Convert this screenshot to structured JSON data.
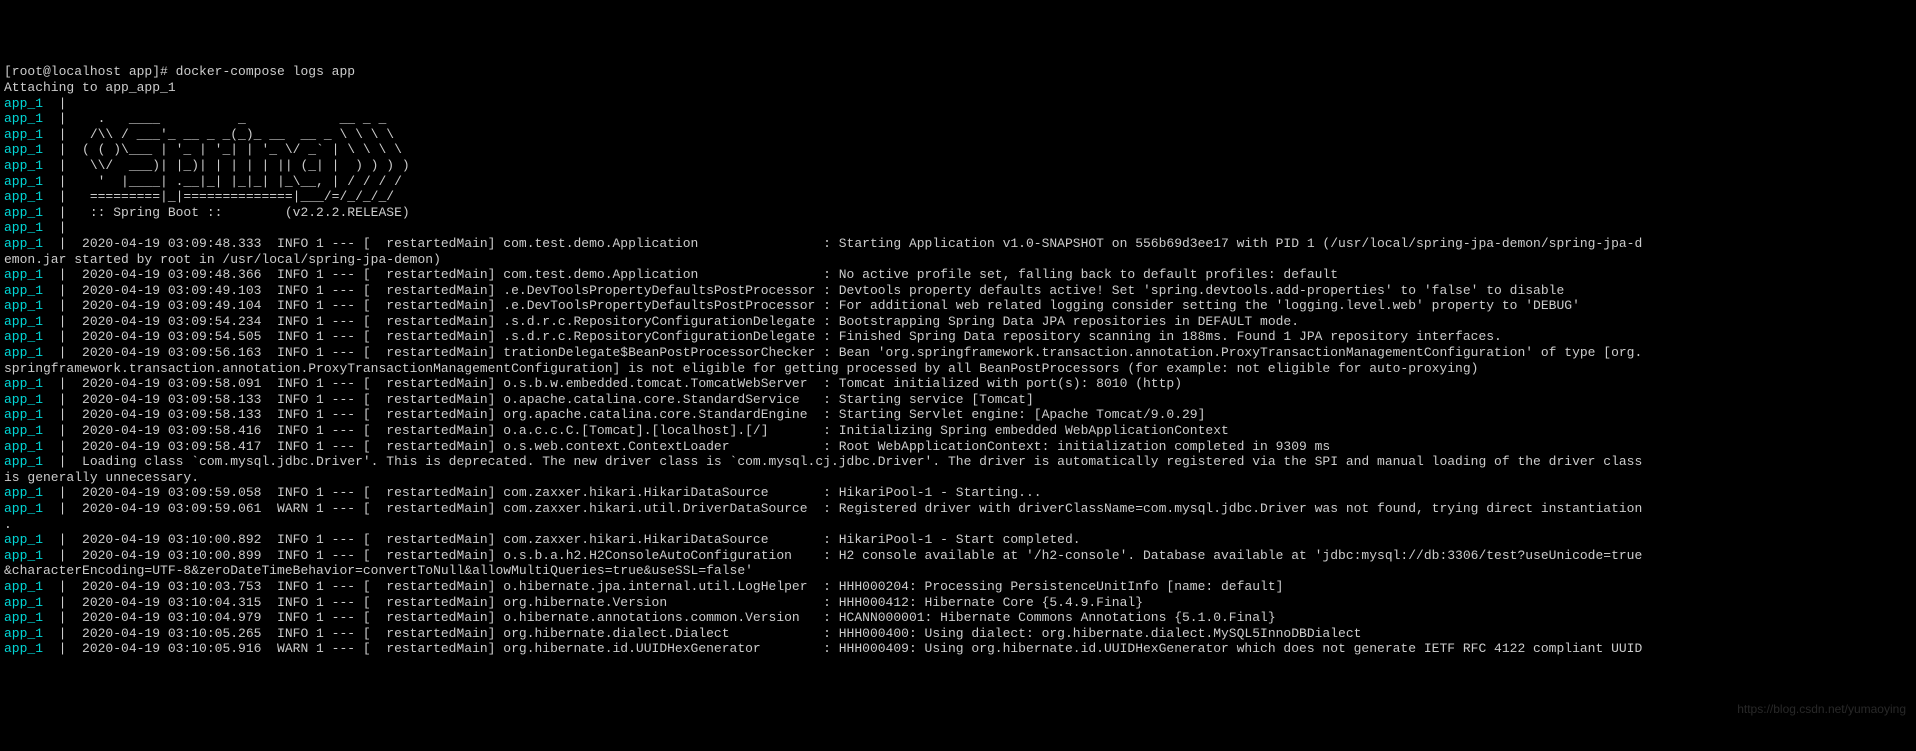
{
  "header": {
    "prompt": "[root@localhost app]# ",
    "command": "docker-compose logs app",
    "attach": "Attaching to app_app_1"
  },
  "prefix": "app_1  ",
  "sep": "| ",
  "lines": [
    " ",
    "   .   ____          _            __ _ _",
    "  /\\\\ / ___'_ __ _ _(_)_ __  __ _ \\ \\ \\ \\",
    " ( ( )\\___ | '_ | '_| | '_ \\/ _` | \\ \\ \\ \\",
    "  \\\\/  ___)| |_)| | | | | || (_| |  ) ) ) )",
    "   '  |____| .__|_| |_|_| |_\\__, | / / / /",
    "  =========|_|==============|___/=/_/_/_/",
    "  :: Spring Boot ::        (v2.2.2.RELEASE)",
    " ",
    " 2020-04-19 03:09:48.333  INFO 1 --- [  restartedMain] com.test.demo.Application                : Starting Application v1.0-SNAPSHOT on 556b69d3ee17 with PID 1 (/usr/local/spring-jpa-demon/spring-jpa-d",
    " 2020-04-19 03:09:48.366  INFO 1 --- [  restartedMain] com.test.demo.Application                : No active profile set, falling back to default profiles: default",
    " 2020-04-19 03:09:49.103  INFO 1 --- [  restartedMain] .e.DevToolsPropertyDefaultsPostProcessor : Devtools property defaults active! Set 'spring.devtools.add-properties' to 'false' to disable",
    " 2020-04-19 03:09:49.104  INFO 1 --- [  restartedMain] .e.DevToolsPropertyDefaultsPostProcessor : For additional web related logging consider setting the 'logging.level.web' property to 'DEBUG'",
    " 2020-04-19 03:09:54.234  INFO 1 --- [  restartedMain] .s.d.r.c.RepositoryConfigurationDelegate : Bootstrapping Spring Data JPA repositories in DEFAULT mode.",
    " 2020-04-19 03:09:54.505  INFO 1 --- [  restartedMain] .s.d.r.c.RepositoryConfigurationDelegate : Finished Spring Data repository scanning in 188ms. Found 1 JPA repository interfaces.",
    " 2020-04-19 03:09:56.163  INFO 1 --- [  restartedMain] trationDelegate$BeanPostProcessorChecker : Bean 'org.springframework.transaction.annotation.ProxyTransactionManagementConfiguration' of type [org.",
    " 2020-04-19 03:09:58.091  INFO 1 --- [  restartedMain] o.s.b.w.embedded.tomcat.TomcatWebServer  : Tomcat initialized with port(s): 8010 (http)",
    " 2020-04-19 03:09:58.133  INFO 1 --- [  restartedMain] o.apache.catalina.core.StandardService   : Starting service [Tomcat]",
    " 2020-04-19 03:09:58.133  INFO 1 --- [  restartedMain] org.apache.catalina.core.StandardEngine  : Starting Servlet engine: [Apache Tomcat/9.0.29]",
    " 2020-04-19 03:09:58.416  INFO 1 --- [  restartedMain] o.a.c.c.C.[Tomcat].[localhost].[/]       : Initializing Spring embedded WebApplicationContext",
    " 2020-04-19 03:09:58.417  INFO 1 --- [  restartedMain] o.s.web.context.ContextLoader            : Root WebApplicationContext: initialization completed in 9309 ms",
    " Loading class `com.mysql.jdbc.Driver'. This is deprecated. The new driver class is `com.mysql.cj.jdbc.Driver'. The driver is automatically registered via the SPI and manual loading of the driver class ",
    " 2020-04-19 03:09:59.058  INFO 1 --- [  restartedMain] com.zaxxer.hikari.HikariDataSource       : HikariPool-1 - Starting...",
    " 2020-04-19 03:09:59.061  WARN 1 --- [  restartedMain] com.zaxxer.hikari.util.DriverDataSource  : Registered driver with driverClassName=com.mysql.jdbc.Driver was not found, trying direct instantiation",
    " 2020-04-19 03:10:00.892  INFO 1 --- [  restartedMain] com.zaxxer.hikari.HikariDataSource       : HikariPool-1 - Start completed.",
    " 2020-04-19 03:10:00.899  INFO 1 --- [  restartedMain] o.s.b.a.h2.H2ConsoleAutoConfiguration    : H2 console available at '/h2-console'. Database available at 'jdbc:mysql://db:3306/test?useUnicode=true",
    " 2020-04-19 03:10:03.753  INFO 1 --- [  restartedMain] o.hibernate.jpa.internal.util.LogHelper  : HHH000204: Processing PersistenceUnitInfo [name: default]",
    " 2020-04-19 03:10:04.315  INFO 1 --- [  restartedMain] org.hibernate.Version                    : HHH000412: Hibernate Core {5.4.9.Final}",
    " 2020-04-19 03:10:04.979  INFO 1 --- [  restartedMain] o.hibernate.annotations.common.Version   : HCANN000001: Hibernate Commons Annotations {5.1.0.Final}",
    " 2020-04-19 03:10:05.265  INFO 1 --- [  restartedMain] org.hibernate.dialect.Dialect            : HHH000400: Using dialect: org.hibernate.dialect.MySQL5InnoDBDialect",
    " 2020-04-19 03:10:05.916  WARN 1 --- [  restartedMain] org.hibernate.id.UUIDHexGenerator        : HHH000409: Using org.hibernate.id.UUIDHexGenerator which does not generate IETF RFC 4122 compliant UUID "
  ],
  "wrapped": {
    "9": "emon.jar started by root in /usr/local/spring-jpa-demon)",
    "15": "springframework.transaction.annotation.ProxyTransactionManagementConfiguration] is not eligible for getting processed by all BeanPostProcessors (for example: not eligible for auto-proxying)",
    "21": "is generally unnecessary.",
    "23": ".",
    "25": "&characterEncoding=UTF-8&zeroDateTimeBehavior=convertToNull&allowMultiQueries=true&useSSL=false'"
  },
  "watermark": "https://blog.csdn.net/yumaoying"
}
